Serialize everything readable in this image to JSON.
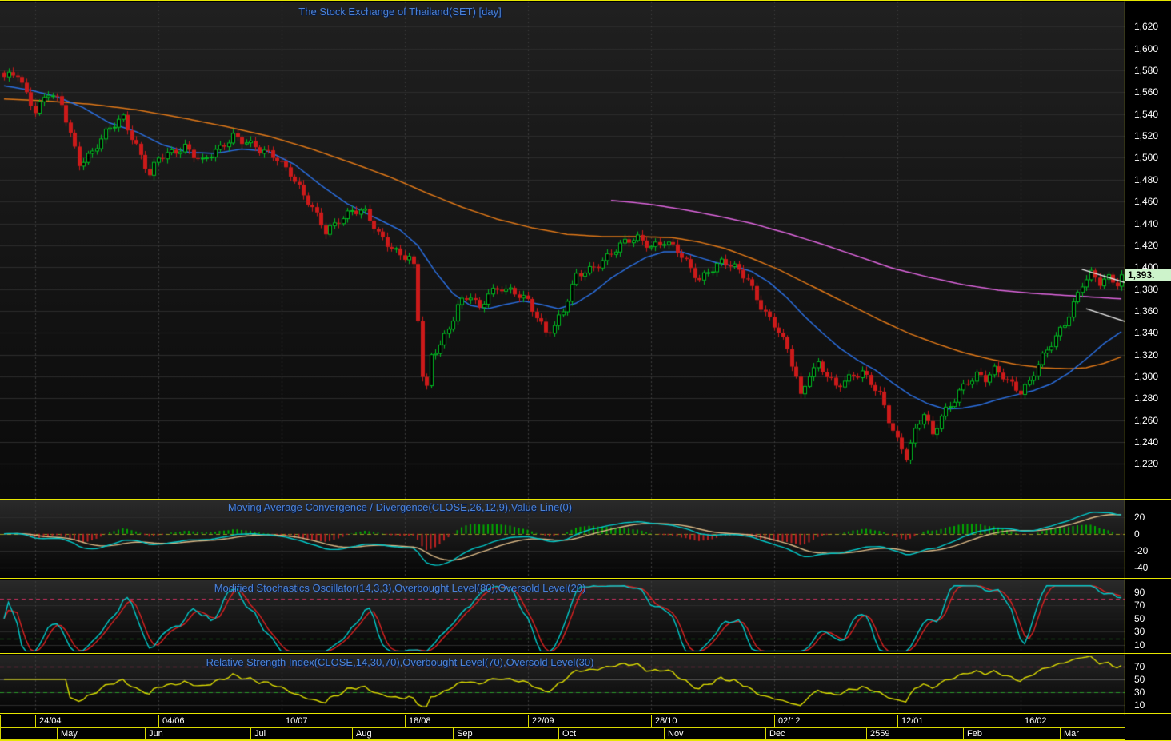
{
  "chart_data": {
    "type": "candlestick",
    "title": "The Stock Exchange of Thailand(SET) [day]",
    "instrument": "SET",
    "interval": "day",
    "last_close_label": "1,393.",
    "last_close": 1393,
    "ylim": [
      1188,
      1643
    ],
    "y_ticks": [
      1620,
      1600,
      1580,
      1560,
      1540,
      1520,
      1500,
      1480,
      1460,
      1440,
      1420,
      1400,
      1380,
      1360,
      1340,
      1320,
      1300,
      1280,
      1260,
      1240,
      1220
    ],
    "days": 255,
    "x_axis": {
      "date_ticks": [
        {
          "label": "24/04",
          "day": 7
        },
        {
          "label": "04/06",
          "day": 35
        },
        {
          "label": "10/07",
          "day": 63
        },
        {
          "label": "18/08",
          "day": 91
        },
        {
          "label": "22/09",
          "day": 119
        },
        {
          "label": "28/10",
          "day": 147
        },
        {
          "label": "02/12",
          "day": 175
        },
        {
          "label": "12/01",
          "day": 203
        },
        {
          "label": "16/02",
          "day": 231
        }
      ],
      "months": [
        {
          "label": "May",
          "day": 12
        },
        {
          "label": "Jun",
          "day": 32
        },
        {
          "label": "Jul",
          "day": 56
        },
        {
          "label": "Aug",
          "day": 79
        },
        {
          "label": "Sep",
          "day": 102
        },
        {
          "label": "Oct",
          "day": 126
        },
        {
          "label": "Nov",
          "day": 150
        },
        {
          "label": "Dec",
          "day": 173
        },
        {
          "label": "2559",
          "day": 196
        },
        {
          "label": "Feb",
          "day": 218
        },
        {
          "label": "Mar",
          "day": 240
        }
      ]
    },
    "close_anchors": [
      [
        0,
        1572
      ],
      [
        3,
        1578
      ],
      [
        5,
        1560
      ],
      [
        7,
        1544
      ],
      [
        10,
        1558
      ],
      [
        13,
        1548
      ],
      [
        17,
        1497
      ],
      [
        20,
        1505
      ],
      [
        24,
        1526
      ],
      [
        27,
        1538
      ],
      [
        30,
        1512
      ],
      [
        33,
        1483
      ],
      [
        35,
        1498
      ],
      [
        38,
        1505
      ],
      [
        41,
        1512
      ],
      [
        45,
        1495
      ],
      [
        49,
        1508
      ],
      [
        52,
        1522
      ],
      [
        55,
        1515
      ],
      [
        58,
        1505
      ],
      [
        62,
        1500
      ],
      [
        65,
        1488
      ],
      [
        68,
        1465
      ],
      [
        71,
        1445
      ],
      [
        73,
        1432
      ],
      [
        76,
        1445
      ],
      [
        79,
        1452
      ],
      [
        82,
        1448
      ],
      [
        85,
        1430
      ],
      [
        88,
        1420
      ],
      [
        90,
        1412
      ],
      [
        92,
        1408
      ],
      [
        93,
        1398
      ],
      [
        94,
        1350
      ],
      [
        95,
        1300
      ],
      [
        96,
        1288
      ],
      [
        97,
        1318
      ],
      [
        99,
        1332
      ],
      [
        101,
        1345
      ],
      [
        103,
        1365
      ],
      [
        106,
        1372
      ],
      [
        108,
        1360
      ],
      [
        110,
        1378
      ],
      [
        113,
        1383
      ],
      [
        116,
        1375
      ],
      [
        119,
        1367
      ],
      [
        121,
        1355
      ],
      [
        123,
        1342
      ],
      [
        125,
        1348
      ],
      [
        127,
        1360
      ],
      [
        130,
        1390
      ],
      [
        133,
        1398
      ],
      [
        136,
        1408
      ],
      [
        139,
        1416
      ],
      [
        141,
        1421
      ],
      [
        144,
        1426
      ],
      [
        147,
        1421
      ],
      [
        150,
        1424
      ],
      [
        153,
        1413
      ],
      [
        156,
        1398
      ],
      [
        158,
        1390
      ],
      [
        160,
        1398
      ],
      [
        163,
        1404
      ],
      [
        166,
        1398
      ],
      [
        169,
        1390
      ],
      [
        171,
        1373
      ],
      [
        174,
        1352
      ],
      [
        176,
        1340
      ],
      [
        178,
        1322
      ],
      [
        180,
        1300
      ],
      [
        181,
        1282
      ],
      [
        183,
        1305
      ],
      [
        185,
        1312
      ],
      [
        187,
        1300
      ],
      [
        189,
        1288
      ],
      [
        191,
        1295
      ],
      [
        193,
        1302
      ],
      [
        195,
        1306
      ],
      [
        197,
        1295
      ],
      [
        199,
        1282
      ],
      [
        201,
        1258
      ],
      [
        203,
        1240
      ],
      [
        205,
        1228
      ],
      [
        207,
        1252
      ],
      [
        209,
        1268
      ],
      [
        211,
        1244
      ],
      [
        213,
        1262
      ],
      [
        215,
        1272
      ],
      [
        217,
        1288
      ],
      [
        219,
        1297
      ],
      [
        221,
        1302
      ],
      [
        223,
        1296
      ],
      [
        225,
        1304
      ],
      [
        227,
        1300
      ],
      [
        229,
        1294
      ],
      [
        231,
        1288
      ],
      [
        233,
        1295
      ],
      [
        235,
        1310
      ],
      [
        237,
        1322
      ],
      [
        239,
        1336
      ],
      [
        241,
        1350
      ],
      [
        243,
        1368
      ],
      [
        245,
        1385
      ],
      [
        247,
        1392
      ],
      [
        249,
        1384
      ],
      [
        251,
        1390
      ],
      [
        253,
        1387
      ],
      [
        254,
        1393
      ]
    ],
    "overlays": [
      {
        "name": "ma-short-blue",
        "color": "#2b6fe0",
        "anchors": [
          [
            0,
            1566
          ],
          [
            6,
            1562
          ],
          [
            12,
            1556
          ],
          [
            18,
            1546
          ],
          [
            24,
            1532
          ],
          [
            30,
            1524
          ],
          [
            36,
            1512
          ],
          [
            42,
            1505
          ],
          [
            48,
            1504
          ],
          [
            54,
            1508
          ],
          [
            60,
            1506
          ],
          [
            66,
            1494
          ],
          [
            72,
            1475
          ],
          [
            78,
            1458
          ],
          [
            84,
            1446
          ],
          [
            90,
            1434
          ],
          [
            94,
            1420
          ],
          [
            98,
            1396
          ],
          [
            102,
            1376
          ],
          [
            106,
            1365
          ],
          [
            110,
            1362
          ],
          [
            114,
            1366
          ],
          [
            118,
            1369
          ],
          [
            122,
            1366
          ],
          [
            126,
            1362
          ],
          [
            130,
            1367
          ],
          [
            134,
            1377
          ],
          [
            138,
            1390
          ],
          [
            142,
            1400
          ],
          [
            146,
            1409
          ],
          [
            150,
            1414
          ],
          [
            154,
            1414
          ],
          [
            158,
            1409
          ],
          [
            162,
            1404
          ],
          [
            166,
            1401
          ],
          [
            170,
            1396
          ],
          [
            174,
            1386
          ],
          [
            178,
            1372
          ],
          [
            182,
            1355
          ],
          [
            186,
            1340
          ],
          [
            190,
            1326
          ],
          [
            194,
            1315
          ],
          [
            198,
            1306
          ],
          [
            202,
            1294
          ],
          [
            206,
            1283
          ],
          [
            210,
            1275
          ],
          [
            214,
            1270
          ],
          [
            218,
            1271
          ],
          [
            222,
            1274
          ],
          [
            226,
            1279
          ],
          [
            230,
            1283
          ],
          [
            234,
            1287
          ],
          [
            238,
            1293
          ],
          [
            242,
            1303
          ],
          [
            246,
            1316
          ],
          [
            250,
            1330
          ],
          [
            254,
            1341
          ]
        ]
      },
      {
        "name": "ma-medium-orange",
        "color": "#e07818",
        "anchors": [
          [
            0,
            1554
          ],
          [
            10,
            1552
          ],
          [
            20,
            1549
          ],
          [
            30,
            1544
          ],
          [
            40,
            1537
          ],
          [
            50,
            1529
          ],
          [
            60,
            1520
          ],
          [
            70,
            1508
          ],
          [
            80,
            1494
          ],
          [
            88,
            1482
          ],
          [
            96,
            1468
          ],
          [
            104,
            1455
          ],
          [
            112,
            1444
          ],
          [
            120,
            1436
          ],
          [
            128,
            1430
          ],
          [
            136,
            1428
          ],
          [
            144,
            1428
          ],
          [
            152,
            1427
          ],
          [
            158,
            1423
          ],
          [
            164,
            1417
          ],
          [
            170,
            1408
          ],
          [
            176,
            1398
          ],
          [
            182,
            1386
          ],
          [
            188,
            1374
          ],
          [
            194,
            1362
          ],
          [
            200,
            1350
          ],
          [
            206,
            1339
          ],
          [
            212,
            1330
          ],
          [
            218,
            1322
          ],
          [
            224,
            1316
          ],
          [
            230,
            1311
          ],
          [
            236,
            1308
          ],
          [
            242,
            1307
          ],
          [
            246,
            1308
          ],
          [
            250,
            1312
          ],
          [
            254,
            1318
          ]
        ]
      },
      {
        "name": "ma-long-magenta",
        "color": "#e066e0",
        "anchors": [
          [
            138,
            1461
          ],
          [
            146,
            1458
          ],
          [
            154,
            1453
          ],
          [
            162,
            1447
          ],
          [
            170,
            1440
          ],
          [
            178,
            1431
          ],
          [
            186,
            1421
          ],
          [
            194,
            1410
          ],
          [
            202,
            1399
          ],
          [
            210,
            1391
          ],
          [
            218,
            1384
          ],
          [
            226,
            1379
          ],
          [
            234,
            1376
          ],
          [
            242,
            1374
          ],
          [
            250,
            1372
          ],
          [
            254,
            1371
          ]
        ]
      }
    ],
    "trendlines": [
      {
        "from": [
          245,
          1398
        ],
        "to": [
          258,
          1382
        ]
      },
      {
        "from": [
          246,
          1362
        ],
        "to": [
          258,
          1346
        ]
      }
    ],
    "sub_charts": [
      {
        "type": "macd",
        "title": "Moving Average Convergence / Divergence(CLOSE,26,12,9),Value Line(0)",
        "params": {
          "slow": 26,
          "fast": 12,
          "signal": 9,
          "value_line": 0
        },
        "y_ticks": [
          20,
          0,
          -20,
          -40
        ],
        "range": [
          -50,
          38
        ]
      },
      {
        "type": "stochastic",
        "title": "Modified Stochastics Oscillator(14,3,3),Overbought Level(80),Oversold Level(20)",
        "params": {
          "k": 14,
          "k_smooth": 3,
          "d": 3
        },
        "overbought": 80,
        "oversold": 20,
        "y_ticks": [
          90,
          70,
          50,
          30,
          10
        ],
        "range": [
          0,
          107
        ]
      },
      {
        "type": "rsi",
        "title": "Relative Strength Index(CLOSE,14,30,70),Overbought Level(70),Oversold Level(30)",
        "params": {
          "period": 14,
          "lower": 30,
          "upper": 70
        },
        "overbought": 70,
        "oversold": 30,
        "y_ticks": [
          70,
          50,
          30,
          10
        ],
        "range": [
          0,
          86
        ]
      }
    ],
    "colors": {
      "frame": "#e6e600",
      "grid": "#2d2d2d",
      "vgrid": "#3c3c3c",
      "candle_up": "#00bb22",
      "candle_down": "#cc1a1a",
      "ma_short": "#2b6fe0",
      "ma_medium": "#e07818",
      "ma_long": "#e066e0",
      "macd_line": "#00cccc",
      "macd_signal": "#ddbb88",
      "hist_up": "#00aa00",
      "hist_down": "#bb2222",
      "zero_line": "#9a9a22",
      "stoch_k": "#00cccc",
      "stoch_d": "#dd2222",
      "overbought": "#cc3060",
      "oversold": "#2a9a2a",
      "rsi_line": "#dddd00",
      "rsi_mid": "#555555",
      "trendline": "#e8e8e8",
      "axis_text": "#ffffff",
      "title_text": "#4c82d6",
      "price_flag_bg": "#cdf3cb"
    }
  }
}
